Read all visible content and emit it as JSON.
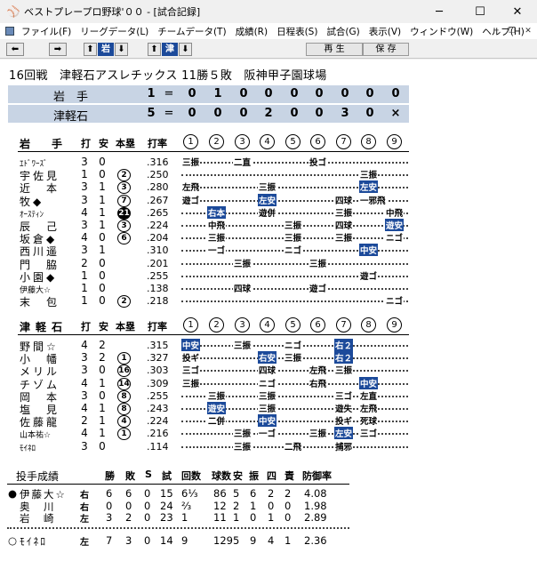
{
  "window": {
    "title": "ベストプレープロ野球'００ - [試合記録]",
    "minimize": "─",
    "maximize": "☐",
    "close": "✕"
  },
  "menu": [
    "ファイル(F)",
    "リーグデータ(L)",
    "チームデータ(T)",
    "成績(R)",
    "日程表(S)",
    "試合(G)",
    "表示(V)",
    "ウィンドウ(W)",
    "ヘルプ(H)"
  ],
  "toolbar": {
    "team1": "岩",
    "team2": "津",
    "replay": "再 生",
    "save": "保 存"
  },
  "game_info": "16回戦　津軽石アスレチックス 11勝５敗　阪神甲子園球場",
  "scoreboard": [
    {
      "team": "岩　手",
      "runs": "1",
      "eq": "=",
      "innings": [
        "0",
        "1",
        "0",
        "0",
        "0",
        "0",
        "0",
        "0",
        "0"
      ]
    },
    {
      "team": "津軽石",
      "runs": "5",
      "eq": "=",
      "innings": [
        "0",
        "0",
        "0",
        "2",
        "0",
        "0",
        "3",
        "0",
        "×"
      ]
    }
  ],
  "batting_headers": {
    "ab": "打",
    "h": "安",
    "hr": "本塁",
    "avg": "打率",
    "innings": [
      "1",
      "2",
      "3",
      "4",
      "5",
      "6",
      "7",
      "8",
      "9"
    ]
  },
  "iwate": {
    "name": "岩　手",
    "batters": [
      {
        "name": "ｴﾄﾞﾜｰｽﾞ",
        "small": true,
        "ab": "3",
        "h": "0",
        "hr": "",
        "avg": ".316",
        "results": [
          {
            "i": 1,
            "t": "三振"
          },
          {
            "i": 3,
            "t": "二直"
          },
          {
            "i": 6,
            "t": "投ゴ"
          }
        ]
      },
      {
        "name": "宇佐見",
        "ab": "1",
        "h": "0",
        "hr": "2",
        "avg": ".250",
        "results": [
          {
            "i": 8,
            "t": "三振"
          }
        ]
      },
      {
        "name": "近　本",
        "ab": "3",
        "h": "1",
        "hr": "3",
        "avg": ".280",
        "results": [
          {
            "i": 1,
            "t": "左飛"
          },
          {
            "i": 4,
            "t": "三振"
          },
          {
            "i": 8,
            "t": "左安",
            "hit": true
          }
        ]
      },
      {
        "name": "牧◆",
        "ab": "3",
        "h": "1",
        "hr": "7",
        "avg": ".267",
        "results": [
          {
            "i": 1,
            "t": "遊ゴ"
          },
          {
            "i": 4,
            "t": "左安",
            "hit": true
          },
          {
            "i": 7,
            "t": "四球"
          },
          {
            "i": 8,
            "t": "一邪飛"
          }
        ]
      },
      {
        "name": "ｵｰｽﾃｨﾝ",
        "small": true,
        "ab": "4",
        "h": "1",
        "hr": "21",
        "hrfill": true,
        "avg": ".265",
        "results": [
          {
            "i": 2,
            "t": "右本",
            "hit": true
          },
          {
            "i": 4,
            "t": "遊併"
          },
          {
            "i": 7,
            "t": "三振"
          },
          {
            "i": 9,
            "t": "中飛"
          }
        ]
      },
      {
        "name": "辰　己",
        "ab": "3",
        "h": "1",
        "hr": "3",
        "avg": ".224",
        "results": [
          {
            "i": 2,
            "t": "中飛"
          },
          {
            "i": 5,
            "t": "三振"
          },
          {
            "i": 7,
            "t": "四球"
          },
          {
            "i": 9,
            "t": "遊安",
            "hit": true
          }
        ]
      },
      {
        "name": "坂倉◆",
        "ab": "4",
        "h": "0",
        "hr": "6",
        "avg": ".204",
        "results": [
          {
            "i": 2,
            "t": "三振"
          },
          {
            "i": 5,
            "t": "三振"
          },
          {
            "i": 7,
            "t": "三振"
          },
          {
            "i": 9,
            "t": "ニゴ"
          }
        ]
      },
      {
        "name": "西川遥",
        "ab": "3",
        "h": "1",
        "hr": "",
        "avg": ".310",
        "results": [
          {
            "i": 2,
            "t": "一ゴ"
          },
          {
            "i": 5,
            "t": "ニゴ"
          },
          {
            "i": 8,
            "t": "中安",
            "hit": true
          }
        ]
      },
      {
        "name": "門　脇",
        "ab": "2",
        "h": "0",
        "hr": "",
        "avg": ".201",
        "results": [
          {
            "i": 3,
            "t": "三振"
          },
          {
            "i": 6,
            "t": "三振"
          }
        ]
      },
      {
        "name": "小園◆",
        "ab": "1",
        "h": "0",
        "hr": "",
        "avg": ".255",
        "results": [
          {
            "i": 8,
            "t": "遊ゴ"
          }
        ]
      },
      {
        "name": "伊藤大☆",
        "small": true,
        "ab": "1",
        "h": "0",
        "hr": "",
        "avg": ".138",
        "results": [
          {
            "i": 3,
            "t": "四球"
          },
          {
            "i": 6,
            "t": "遊ゴ"
          }
        ]
      },
      {
        "name": "末　包",
        "ab": "1",
        "h": "0",
        "hr": "2",
        "avg": ".218",
        "results": [
          {
            "i": 9,
            "t": "ニゴ"
          }
        ]
      }
    ]
  },
  "tsugaru": {
    "name": "津軽石",
    "batters": [
      {
        "name": "野間☆",
        "ab": "4",
        "h": "2",
        "hr": "",
        "avg": ".315",
        "results": [
          {
            "i": 1,
            "t": "中安",
            "hit": true
          },
          {
            "i": 3,
            "t": "三振"
          },
          {
            "i": 5,
            "t": "ニゴ"
          },
          {
            "i": 7,
            "t": "右２",
            "hit": true
          }
        ]
      },
      {
        "name": "小　幡",
        "ab": "3",
        "h": "2",
        "hr": "1",
        "avg": ".327",
        "results": [
          {
            "i": 1,
            "t": "投ギ"
          },
          {
            "i": 4,
            "t": "右安",
            "hit": true
          },
          {
            "i": 5,
            "t": "三振"
          },
          {
            "i": 7,
            "t": "右２",
            "hit": true
          }
        ]
      },
      {
        "name": "メリル",
        "ab": "3",
        "h": "0",
        "hr": "16",
        "avg": ".303",
        "results": [
          {
            "i": 1,
            "t": "三ゴ"
          },
          {
            "i": 4,
            "t": "四球"
          },
          {
            "i": 6,
            "t": "左飛"
          },
          {
            "i": 7,
            "t": "三振"
          }
        ]
      },
      {
        "name": "チゾム",
        "ab": "4",
        "h": "1",
        "hr": "14",
        "avg": ".309",
        "results": [
          {
            "i": 1,
            "t": "三振"
          },
          {
            "i": 4,
            "t": "ニゴ"
          },
          {
            "i": 6,
            "t": "右飛"
          },
          {
            "i": 8,
            "t": "中安",
            "hit": true
          }
        ]
      },
      {
        "name": "岡　本",
        "ab": "3",
        "h": "0",
        "hr": "8",
        "avg": ".255",
        "results": [
          {
            "i": 2,
            "t": "三振"
          },
          {
            "i": 4,
            "t": "三振"
          },
          {
            "i": 7,
            "t": "三ゴ"
          },
          {
            "i": 8,
            "t": "左直"
          }
        ]
      },
      {
        "name": "塩　見",
        "ab": "4",
        "h": "1",
        "hr": "8",
        "avg": ".243",
        "results": [
          {
            "i": 2,
            "t": "遊安",
            "hit": true
          },
          {
            "i": 4,
            "t": "三振"
          },
          {
            "i": 7,
            "t": "遊失"
          },
          {
            "i": 8,
            "t": "左飛"
          }
        ]
      },
      {
        "name": "佐藤龍",
        "ab": "2",
        "h": "1",
        "hr": "4",
        "avg": ".224",
        "results": [
          {
            "i": 2,
            "t": "二併"
          },
          {
            "i": 4,
            "t": "中安",
            "hit": true
          },
          {
            "i": 7,
            "t": "投ギ"
          },
          {
            "i": 8,
            "t": "死球"
          }
        ]
      },
      {
        "name": "山本祐☆",
        "small": true,
        "ab": "4",
        "h": "1",
        "hr": "1",
        "avg": ".216",
        "results": [
          {
            "i": 3,
            "t": "三振"
          },
          {
            "i": 4,
            "t": "一ゴ"
          },
          {
            "i": 6,
            "t": "三振"
          },
          {
            "i": 7,
            "t": "左安",
            "hit": true
          },
          {
            "i": 8,
            "t": "三ゴ"
          }
        ]
      },
      {
        "name": "ﾓｲﾈﾛ",
        "small": true,
        "ab": "3",
        "h": "0",
        "hr": "",
        "avg": ".114",
        "results": [
          {
            "i": 3,
            "t": "三振"
          },
          {
            "i": 5,
            "t": "二飛"
          },
          {
            "i": 7,
            "t": "捕邪"
          }
        ]
      }
    ]
  },
  "pitching": {
    "title": "投手成績",
    "headers": [
      "勝",
      "敗",
      "S",
      "試",
      "回数",
      "球数",
      "安",
      "振",
      "四",
      "責",
      "防御率"
    ],
    "iwate": [
      {
        "mark": "●",
        "name": "伊藤大☆",
        "hand": "右",
        "w": "6",
        "l": "6",
        "s": "0",
        "g": "15",
        "ip": "6⅓",
        "np": "86",
        "h": "5",
        "k": "6",
        "bb": "2",
        "er": "2",
        "era": "4.08"
      },
      {
        "mark": "",
        "name": "奥　川",
        "hand": "右",
        "w": "0",
        "l": "0",
        "s": "0",
        "g": "24",
        "ip": "⅔",
        "np": "12",
        "h": "2",
        "k": "1",
        "bb": "0",
        "er": "0",
        "era": "1.98"
      },
      {
        "mark": "",
        "name": "岩　崎",
        "hand": "左",
        "w": "3",
        "l": "2",
        "s": "0",
        "g": "23",
        "ip": "1",
        "np": "11",
        "h": "1",
        "k": "0",
        "bb": "1",
        "er": "0",
        "era": "2.89"
      }
    ],
    "tsugaru": [
      {
        "mark": "○",
        "name": "ﾓｲﾈﾛ",
        "hand": "左",
        "w": "7",
        "l": "3",
        "s": "0",
        "g": "14",
        "ip": "9",
        "np": "129",
        "h": "5",
        "k": "9",
        "bb": "4",
        "er": "1",
        "era": "2.36"
      }
    ]
  }
}
